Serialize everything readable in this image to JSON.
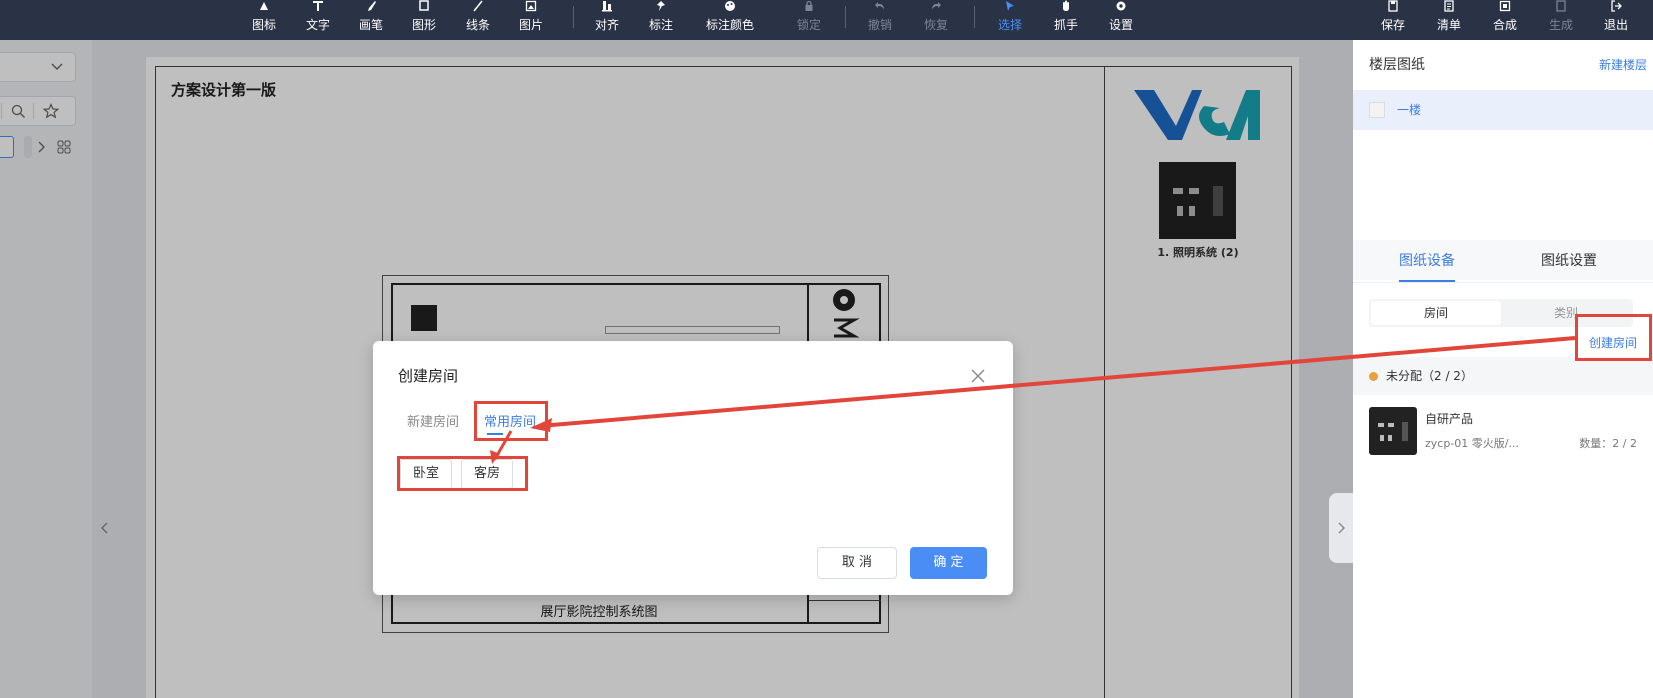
{
  "toolbar": {
    "items": [
      {
        "label": "图标",
        "icon": "icon-library-icon"
      },
      {
        "label": "文字",
        "icon": "text-icon"
      },
      {
        "label": "画笔",
        "icon": "brush-icon"
      },
      {
        "label": "图形",
        "icon": "shape-icon"
      },
      {
        "label": "线条",
        "icon": "line-icon"
      },
      {
        "label": "图片",
        "icon": "image-icon"
      },
      {
        "label": "对齐",
        "icon": "align-icon"
      },
      {
        "label": "标注",
        "icon": "pin-icon"
      },
      {
        "label": "标注颜色",
        "icon": "palette-icon"
      },
      {
        "label": "锁定",
        "icon": "lock-icon"
      },
      {
        "label": "撤销",
        "icon": "undo-icon"
      },
      {
        "label": "恢复",
        "icon": "redo-icon"
      },
      {
        "label": "选择",
        "icon": "cursor-icon"
      },
      {
        "label": "抓手",
        "icon": "hand-icon"
      },
      {
        "label": "设置",
        "icon": "gear-icon"
      }
    ],
    "right_items": [
      {
        "label": "保存",
        "icon": "save-icon"
      },
      {
        "label": "清单",
        "icon": "list-icon"
      },
      {
        "label": "合成",
        "icon": "compose-icon"
      },
      {
        "label": "生成",
        "icon": "generate-icon"
      },
      {
        "label": "退出",
        "icon": "exit-icon"
      }
    ]
  },
  "sheet": {
    "title": "方案设计第一版",
    "device_caption": "1. 照明系统 (2)",
    "drawing_caption": "展厅影院控制系统图"
  },
  "right_panel": {
    "floor_header": "楼层图纸",
    "new_floor": "新建楼层",
    "floor_name": "一楼",
    "tab_devices": "图纸设备",
    "tab_settings": "图纸设置",
    "seg_room": "房间",
    "seg_category": "类别",
    "create_room": "创建房间",
    "group_label": "未分配（2 / 2）",
    "device": {
      "name": "自研产品",
      "sub": "zycp-01 零火版/...",
      "qty": "数量：2 / 2"
    }
  },
  "dialog": {
    "title": "创建房间",
    "tab_new": "新建房间",
    "tab_common": "常用房间",
    "rooms": [
      "卧室",
      "客房"
    ],
    "cancel": "取 消",
    "ok": "确 定"
  },
  "colors": {
    "toolbar_bg": "#2a3245",
    "accent": "#4a8ef5",
    "annotation": "#e2453a"
  }
}
